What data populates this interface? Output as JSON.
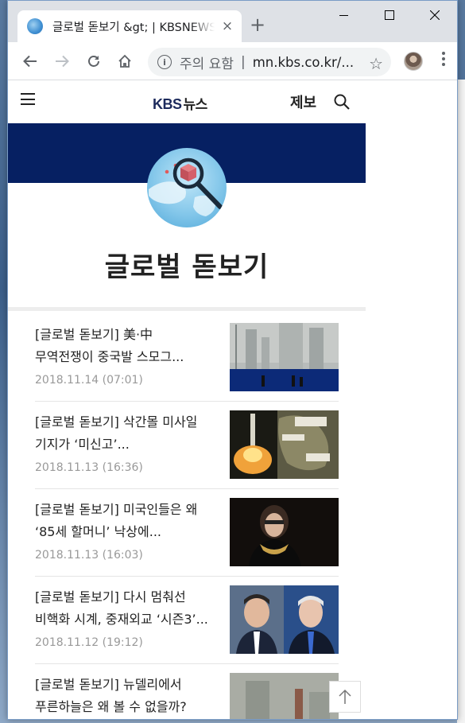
{
  "browser": {
    "tab_title": "글로벌 돋보기 &gt; | KBSNEWS",
    "tab_close": "×",
    "new_tab": "+",
    "omnibox_warning": "주의 요함",
    "omnibox_separator": "|",
    "omnibox_url": "mn.kbs.co.kr/...",
    "star": "☆"
  },
  "site": {
    "logo_main": "KBS",
    "logo_sub": "뉴스",
    "report_label": "제보",
    "section_title": "글로벌 돋보기"
  },
  "articles": [
    {
      "title_line1": "[글로벌 돋보기] 美·中",
      "title_line2": "무역전쟁이 중국발 스모그...",
      "date": "2018.11.14 (07:01)",
      "thumb": "smog-city-photo"
    },
    {
      "title_line1": "[글로벌 돋보기] 삭간몰 미사일",
      "title_line2": "기지가 ‘미신고’...",
      "date": "2018.11.13 (16:36)",
      "thumb": "missile-launch-photo"
    },
    {
      "title_line1": "[글로벌 돋보기] 미국인들은 왜",
      "title_line2": "‘85세 할머니’ 낙상에...",
      "date": "2018.11.13 (16:03)",
      "thumb": "justice-portrait-photo"
    },
    {
      "title_line1": "[글로벌 돋보기] 다시 멈춰선",
      "title_line2": "비핵화 시계, 중재외교 ‘시즌3’...",
      "date": "2018.11.12 (19:12)",
      "thumb": "leaders-meeting-photo"
    },
    {
      "title_line1": "[글로벌 돋보기] 뉴델리에서",
      "title_line2": "푸른하늘은 왜 볼 수 없을까?",
      "date": "",
      "thumb": "delhi-haze-photo"
    }
  ],
  "colors": {
    "banner": "#062062",
    "logo": "#1c2a5c"
  }
}
